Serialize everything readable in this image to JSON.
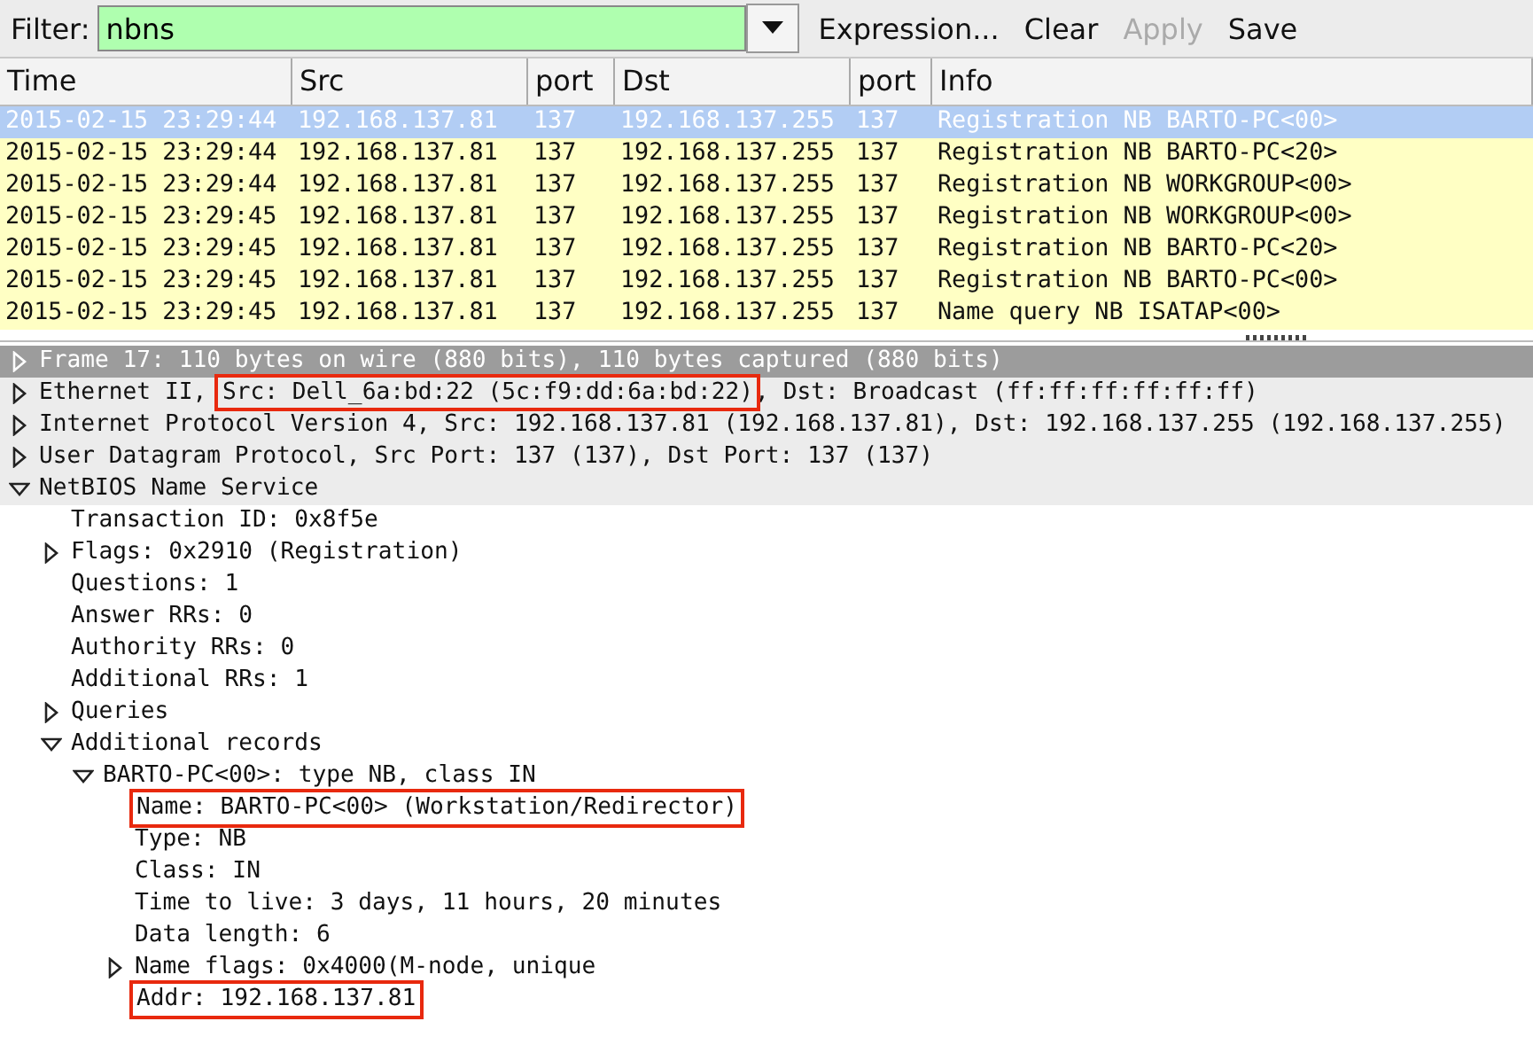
{
  "filter": {
    "label": "Filter:",
    "value": "nbns",
    "buttons": [
      {
        "label": "Expression...",
        "disabled": false
      },
      {
        "label": "Clear",
        "disabled": false
      },
      {
        "label": "Apply",
        "disabled": true
      },
      {
        "label": "Save",
        "disabled": false
      }
    ]
  },
  "packets": {
    "columns": [
      "Time",
      "Src",
      "port",
      "Dst",
      "port",
      "Info"
    ],
    "rows": [
      {
        "selected": true,
        "cells": [
          "2015-02-15 23:29:44",
          "192.168.137.81",
          "137",
          "192.168.137.255",
          "137",
          "Registration NB BARTO-PC<00>"
        ]
      },
      {
        "selected": false,
        "cells": [
          "2015-02-15 23:29:44",
          "192.168.137.81",
          "137",
          "192.168.137.255",
          "137",
          "Registration NB BARTO-PC<20>"
        ]
      },
      {
        "selected": false,
        "cells": [
          "2015-02-15 23:29:44",
          "192.168.137.81",
          "137",
          "192.168.137.255",
          "137",
          "Registration NB WORKGROUP<00>"
        ]
      },
      {
        "selected": false,
        "cells": [
          "2015-02-15 23:29:45",
          "192.168.137.81",
          "137",
          "192.168.137.255",
          "137",
          "Registration NB WORKGROUP<00>"
        ]
      },
      {
        "selected": false,
        "cells": [
          "2015-02-15 23:29:45",
          "192.168.137.81",
          "137",
          "192.168.137.255",
          "137",
          "Registration NB BARTO-PC<20>"
        ]
      },
      {
        "selected": false,
        "cells": [
          "2015-02-15 23:29:45",
          "192.168.137.81",
          "137",
          "192.168.137.255",
          "137",
          "Registration NB BARTO-PC<00>"
        ]
      },
      {
        "selected": false,
        "cells": [
          "2015-02-15 23:29:45",
          "192.168.137.81",
          "137",
          "192.168.137.255",
          "137",
          "Name query NB ISATAP<00>"
        ]
      }
    ]
  },
  "details": [
    {
      "parts": [
        {
          "text": "Frame 17: 110 bytes on wire (880 bits), 110 bytes captured (880 bits)",
          "boxed": false
        }
      ],
      "expanded": false,
      "selected": true
    },
    {
      "parts": [
        {
          "text": "Ethernet II, ",
          "boxed": false
        },
        {
          "text": "Src: Dell_6a:bd:22 (5c:f9:dd:6a:bd:22)",
          "boxed": true
        },
        {
          "text": ", Dst: Broadcast (ff:ff:ff:ff:ff:ff)",
          "boxed": false
        }
      ],
      "expanded": false,
      "selected": false
    },
    {
      "parts": [
        {
          "text": "Internet Protocol Version 4, Src: 192.168.137.81 (192.168.137.81), Dst: 192.168.137.255 (192.168.137.255)",
          "boxed": false
        }
      ],
      "expanded": false,
      "selected": false
    },
    {
      "parts": [
        {
          "text": "User Datagram Protocol, Src Port: 137 (137), Dst Port: 137 (137)",
          "boxed": false
        }
      ],
      "expanded": false,
      "selected": false
    },
    {
      "parts": [
        {
          "text": "NetBIOS Name Service",
          "boxed": false
        }
      ],
      "expanded": true,
      "selected": false,
      "children": [
        {
          "parts": [
            {
              "text": "Transaction ID: 0x8f5e",
              "boxed": false
            }
          ],
          "selected": false
        },
        {
          "parts": [
            {
              "text": "Flags: 0x2910 (Registration)",
              "boxed": false
            }
          ],
          "expanded": false,
          "selected": false
        },
        {
          "parts": [
            {
              "text": "Questions: 1",
              "boxed": false
            }
          ],
          "selected": false
        },
        {
          "parts": [
            {
              "text": "Answer RRs: 0",
              "boxed": false
            }
          ],
          "selected": false
        },
        {
          "parts": [
            {
              "text": "Authority RRs: 0",
              "boxed": false
            }
          ],
          "selected": false
        },
        {
          "parts": [
            {
              "text": "Additional RRs: 1",
              "boxed": false
            }
          ],
          "selected": false
        },
        {
          "parts": [
            {
              "text": "Queries",
              "boxed": false
            }
          ],
          "expanded": false,
          "selected": false
        },
        {
          "parts": [
            {
              "text": "Additional records",
              "boxed": false
            }
          ],
          "expanded": true,
          "selected": false,
          "children": [
            {
              "parts": [
                {
                  "text": "BARTO-PC<00>: type NB, class IN",
                  "boxed": false
                }
              ],
              "expanded": true,
              "selected": false,
              "children": [
                {
                  "parts": [
                    {
                      "text": "Name: BARTO-PC<00> (Workstation/Redirector)",
                      "boxed": true
                    }
                  ],
                  "selected": false
                },
                {
                  "parts": [
                    {
                      "text": "Type: NB",
                      "boxed": false
                    }
                  ],
                  "selected": false
                },
                {
                  "parts": [
                    {
                      "text": "Class: IN",
                      "boxed": false
                    }
                  ],
                  "selected": false
                },
                {
                  "parts": [
                    {
                      "text": "Time to live: 3 days, 11 hours, 20 minutes",
                      "boxed": false
                    }
                  ],
                  "selected": false
                },
                {
                  "parts": [
                    {
                      "text": "Data length: 6",
                      "boxed": false
                    }
                  ],
                  "selected": false
                },
                {
                  "parts": [
                    {
                      "text": "Name flags: 0x4000(M-node, unique",
                      "boxed": false
                    }
                  ],
                  "expanded": false,
                  "selected": false
                },
                {
                  "parts": [
                    {
                      "text": "Addr: 192.168.137.81",
                      "boxed": true
                    }
                  ],
                  "selected": false
                }
              ]
            }
          ]
        }
      ]
    }
  ]
}
